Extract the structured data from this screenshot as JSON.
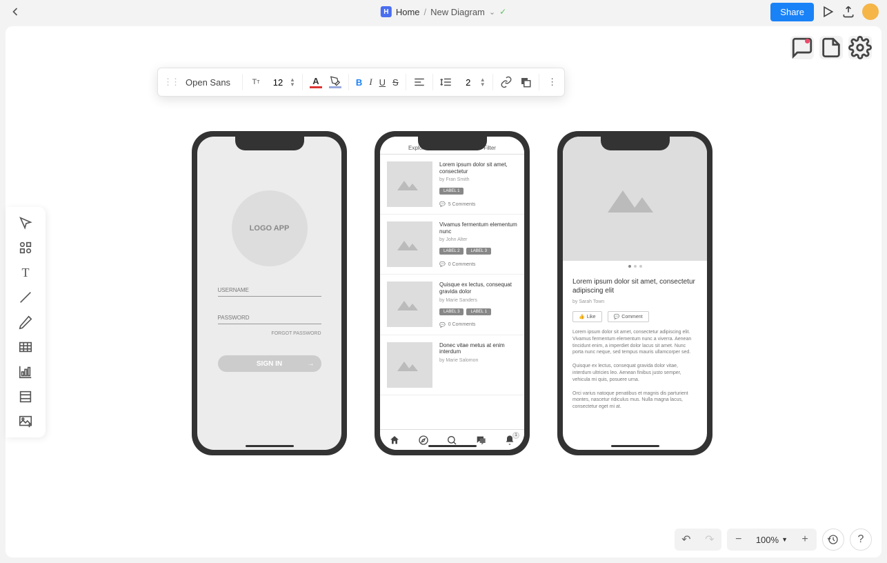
{
  "header": {
    "home": "Home",
    "current": "New Diagram",
    "share": "Share"
  },
  "toolbar": {
    "font": "Open Sans",
    "size": "12",
    "line": "2"
  },
  "zoom": "100%",
  "phone1": {
    "logo": "LOGO APP",
    "user": "USERNAME",
    "pass": "PASSWORD",
    "forgot": "FORGOT PASSWORD",
    "signin": "SIGN IN"
  },
  "phone2": {
    "tab1": "Explore",
    "tab2": "Filter",
    "badge": "1",
    "posts": [
      {
        "title": "Lorem ipsum dolor sit amet, consectetur",
        "by": "by Fran Smith",
        "labels": [
          "LABEL 1"
        ],
        "comments": "5 Comments"
      },
      {
        "title": "Vivamus fermentum elementum nunc",
        "by": "by John Alter",
        "labels": [
          "LABEL 2",
          "LABEL 3"
        ],
        "comments": "0 Comments"
      },
      {
        "title": "Quisque ex lectus, consequat gravida dolor",
        "by": "by Marie Sanders",
        "labels": [
          "LABEL 3",
          "LABEL 1"
        ],
        "comments": "0 Comments"
      },
      {
        "title": "Donec vitae metus at enim interdum",
        "by": "by Marie Salomon",
        "labels": [],
        "comments": ""
      }
    ]
  },
  "phone3": {
    "title": "Lorem ipsum dolor sit amet, consectetur adipiscing elit",
    "by": "by Sarah Town",
    "like": "Like",
    "comment": "Comment",
    "p1": "Lorem ipsum dolor sit amet, consectetur adipiscing elit. Vivamus fermentum elementum nunc a viverra. Aenean tincidunt enim, a imperdiet dolor lacus sit amet. Nunc porta nunc neque, sed tempus mauris ullamcorper sed.",
    "p2": "Quisque ex lectus, consequat gravida dolor vitae, interdum ultricies leo. Aenean finibus justo semper, vehicula mi quis, posuere urna.",
    "p3": "Orci varius natoque penatibus et magnis dis parturient montes, nascetur ridiculus mus. Nulla magna lacus, consectetur eget mi at."
  }
}
